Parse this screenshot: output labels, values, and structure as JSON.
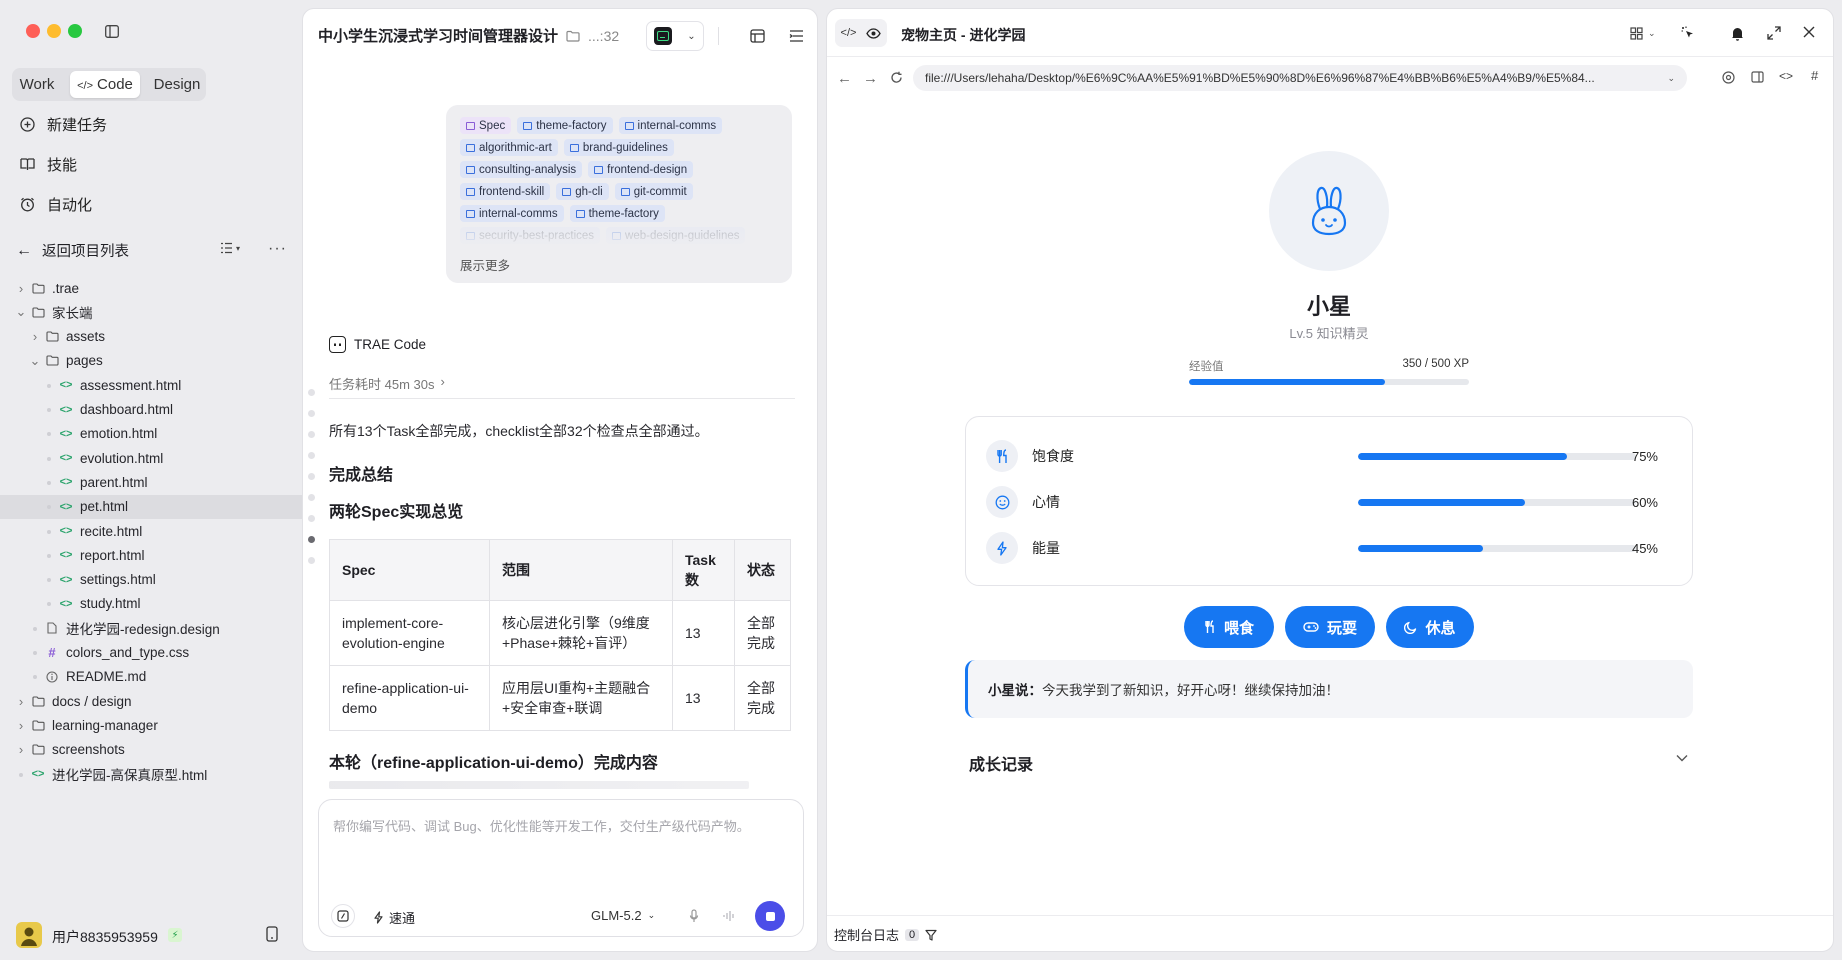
{
  "sidebar": {
    "mode_tabs": [
      "Work",
      "Code",
      "Design"
    ],
    "active_mode": "Code",
    "nav": [
      {
        "label": "新建任务",
        "icon": "new-task-icon"
      },
      {
        "label": "技能",
        "icon": "book-icon"
      },
      {
        "label": "自动化",
        "icon": "alarm-clock-icon"
      }
    ],
    "back_label": "返回项目列表",
    "tree": [
      {
        "label": ".trae",
        "type": "folder",
        "depth": 0,
        "open": false
      },
      {
        "label": "家长端",
        "type": "folder",
        "depth": 0,
        "open": true
      },
      {
        "label": "assets",
        "type": "folder",
        "depth": 1,
        "open": false
      },
      {
        "label": "pages",
        "type": "folder",
        "depth": 1,
        "open": true
      },
      {
        "label": "assessment.html",
        "type": "html",
        "depth": 2
      },
      {
        "label": "dashboard.html",
        "type": "html",
        "depth": 2
      },
      {
        "label": "emotion.html",
        "type": "html",
        "depth": 2
      },
      {
        "label": "evolution.html",
        "type": "html",
        "depth": 2
      },
      {
        "label": "parent.html",
        "type": "html",
        "depth": 2
      },
      {
        "label": "pet.html",
        "type": "html",
        "depth": 2,
        "selected": true
      },
      {
        "label": "recite.html",
        "type": "html",
        "depth": 2
      },
      {
        "label": "report.html",
        "type": "html",
        "depth": 2
      },
      {
        "label": "settings.html",
        "type": "html",
        "depth": 2
      },
      {
        "label": "study.html",
        "type": "html",
        "depth": 2
      },
      {
        "label": "进化学园-redesign.design",
        "type": "file",
        "depth": 1
      },
      {
        "label": "colors_and_type.css",
        "type": "css",
        "depth": 1
      },
      {
        "label": "README.md",
        "type": "info",
        "depth": 1
      },
      {
        "label": "docs / design",
        "type": "folder",
        "depth": 0,
        "open": false
      },
      {
        "label": "learning-manager",
        "type": "folder",
        "depth": 0,
        "open": false
      },
      {
        "label": "screenshots",
        "type": "folder",
        "depth": 0,
        "open": false
      },
      {
        "label": "进化学园-高保真原型.html",
        "type": "html",
        "depth": 0
      }
    ],
    "user_name": "用户8835953959"
  },
  "chat": {
    "title": "中小学生沉浸式学习时间管理器设计",
    "title_suffix": "...:32",
    "tags": [
      "Spec",
      "theme-factory",
      "internal-comms",
      "algorithmic-art",
      "brand-guidelines",
      "consulting-analysis",
      "frontend-design",
      "frontend-skill",
      "gh-cli",
      "git-commit",
      "internal-comms",
      "theme-factory",
      "security-best-practices",
      "web-design-guidelines"
    ],
    "show_more": "展示更多",
    "agent_name": "TRAE Code",
    "duration": "任务耗时 45m 30s",
    "summary_line": "所有13个Task全部完成，checklist全部32个检查点全部通过。",
    "heading1": "完成总结",
    "heading2": "两轮Spec实现总览",
    "table": {
      "headers": [
        "Spec",
        "范围",
        "Task数",
        "状态"
      ],
      "rows": [
        [
          "implement-core-evolution-engine",
          "核心层进化引擎（9维度+Phase+棘轮+盲评）",
          "13",
          "全部完成"
        ],
        [
          "refine-application-ui-demo",
          "应用层UI重构+主题融合+安全审查+联调",
          "13",
          "全部完成"
        ]
      ]
    },
    "heading3": "本轮（refine-application-ui-demo）完成内容",
    "input_placeholder": "帮你编写代码、调试 Bug、优化性能等开发工作，交付生产级代码产物。",
    "speed_label": "速通",
    "model_label": "GLM-5.2"
  },
  "preview": {
    "tab_title": "宠物主页 - 进化学园",
    "url": "file:///Users/lehaha/Desktop/%E6%9C%AA%E5%91%BD%E5%90%8D%E6%96%87%E4%BB%B6%E5%A4%B9/%E5%84...",
    "pet": {
      "name": "小星",
      "level": "Lv.5 知识精灵",
      "xp_label": "经验值",
      "xp_text": "350 / 500 XP",
      "xp_fraction": 0.7
    },
    "stats": [
      {
        "label": "饱食度",
        "percent": "75%",
        "value": 0.75,
        "icon": "fork-knife-icon"
      },
      {
        "label": "心情",
        "percent": "60%",
        "value": 0.6,
        "icon": "smiley-icon"
      },
      {
        "label": "能量",
        "percent": "45%",
        "value": 0.45,
        "icon": "lightning-icon"
      }
    ],
    "actions": [
      "喂食",
      "玩耍",
      "休息"
    ],
    "speech_speaker": "小星说：",
    "speech_text": "今天我学到了新知识，好开心呀！继续保持加油！",
    "growth_title": "成长记录",
    "console_label": "控制台日志",
    "console_count": "0",
    "accent": "#1677f2"
  }
}
